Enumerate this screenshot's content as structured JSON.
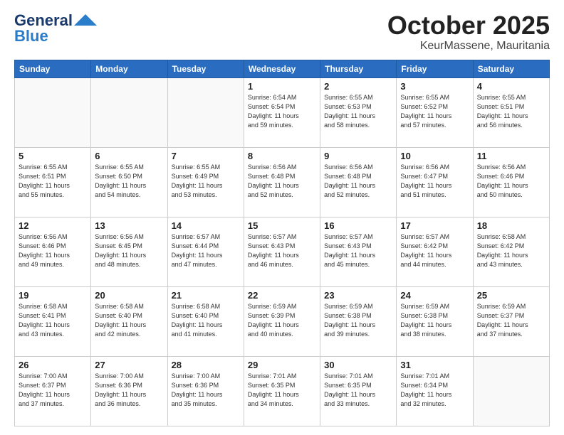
{
  "header": {
    "logo_general": "General",
    "logo_blue": "Blue",
    "month": "October 2025",
    "location": "KeurMassene, Mauritania"
  },
  "weekdays": [
    "Sunday",
    "Monday",
    "Tuesday",
    "Wednesday",
    "Thursday",
    "Friday",
    "Saturday"
  ],
  "weeks": [
    [
      {
        "day": "",
        "info": ""
      },
      {
        "day": "",
        "info": ""
      },
      {
        "day": "",
        "info": ""
      },
      {
        "day": "1",
        "info": "Sunrise: 6:54 AM\nSunset: 6:54 PM\nDaylight: 11 hours\nand 59 minutes."
      },
      {
        "day": "2",
        "info": "Sunrise: 6:55 AM\nSunset: 6:53 PM\nDaylight: 11 hours\nand 58 minutes."
      },
      {
        "day": "3",
        "info": "Sunrise: 6:55 AM\nSunset: 6:52 PM\nDaylight: 11 hours\nand 57 minutes."
      },
      {
        "day": "4",
        "info": "Sunrise: 6:55 AM\nSunset: 6:51 PM\nDaylight: 11 hours\nand 56 minutes."
      }
    ],
    [
      {
        "day": "5",
        "info": "Sunrise: 6:55 AM\nSunset: 6:51 PM\nDaylight: 11 hours\nand 55 minutes."
      },
      {
        "day": "6",
        "info": "Sunrise: 6:55 AM\nSunset: 6:50 PM\nDaylight: 11 hours\nand 54 minutes."
      },
      {
        "day": "7",
        "info": "Sunrise: 6:55 AM\nSunset: 6:49 PM\nDaylight: 11 hours\nand 53 minutes."
      },
      {
        "day": "8",
        "info": "Sunrise: 6:56 AM\nSunset: 6:48 PM\nDaylight: 11 hours\nand 52 minutes."
      },
      {
        "day": "9",
        "info": "Sunrise: 6:56 AM\nSunset: 6:48 PM\nDaylight: 11 hours\nand 52 minutes."
      },
      {
        "day": "10",
        "info": "Sunrise: 6:56 AM\nSunset: 6:47 PM\nDaylight: 11 hours\nand 51 minutes."
      },
      {
        "day": "11",
        "info": "Sunrise: 6:56 AM\nSunset: 6:46 PM\nDaylight: 11 hours\nand 50 minutes."
      }
    ],
    [
      {
        "day": "12",
        "info": "Sunrise: 6:56 AM\nSunset: 6:46 PM\nDaylight: 11 hours\nand 49 minutes."
      },
      {
        "day": "13",
        "info": "Sunrise: 6:56 AM\nSunset: 6:45 PM\nDaylight: 11 hours\nand 48 minutes."
      },
      {
        "day": "14",
        "info": "Sunrise: 6:57 AM\nSunset: 6:44 PM\nDaylight: 11 hours\nand 47 minutes."
      },
      {
        "day": "15",
        "info": "Sunrise: 6:57 AM\nSunset: 6:43 PM\nDaylight: 11 hours\nand 46 minutes."
      },
      {
        "day": "16",
        "info": "Sunrise: 6:57 AM\nSunset: 6:43 PM\nDaylight: 11 hours\nand 45 minutes."
      },
      {
        "day": "17",
        "info": "Sunrise: 6:57 AM\nSunset: 6:42 PM\nDaylight: 11 hours\nand 44 minutes."
      },
      {
        "day": "18",
        "info": "Sunrise: 6:58 AM\nSunset: 6:42 PM\nDaylight: 11 hours\nand 43 minutes."
      }
    ],
    [
      {
        "day": "19",
        "info": "Sunrise: 6:58 AM\nSunset: 6:41 PM\nDaylight: 11 hours\nand 43 minutes."
      },
      {
        "day": "20",
        "info": "Sunrise: 6:58 AM\nSunset: 6:40 PM\nDaylight: 11 hours\nand 42 minutes."
      },
      {
        "day": "21",
        "info": "Sunrise: 6:58 AM\nSunset: 6:40 PM\nDaylight: 11 hours\nand 41 minutes."
      },
      {
        "day": "22",
        "info": "Sunrise: 6:59 AM\nSunset: 6:39 PM\nDaylight: 11 hours\nand 40 minutes."
      },
      {
        "day": "23",
        "info": "Sunrise: 6:59 AM\nSunset: 6:38 PM\nDaylight: 11 hours\nand 39 minutes."
      },
      {
        "day": "24",
        "info": "Sunrise: 6:59 AM\nSunset: 6:38 PM\nDaylight: 11 hours\nand 38 minutes."
      },
      {
        "day": "25",
        "info": "Sunrise: 6:59 AM\nSunset: 6:37 PM\nDaylight: 11 hours\nand 37 minutes."
      }
    ],
    [
      {
        "day": "26",
        "info": "Sunrise: 7:00 AM\nSunset: 6:37 PM\nDaylight: 11 hours\nand 37 minutes."
      },
      {
        "day": "27",
        "info": "Sunrise: 7:00 AM\nSunset: 6:36 PM\nDaylight: 11 hours\nand 36 minutes."
      },
      {
        "day": "28",
        "info": "Sunrise: 7:00 AM\nSunset: 6:36 PM\nDaylight: 11 hours\nand 35 minutes."
      },
      {
        "day": "29",
        "info": "Sunrise: 7:01 AM\nSunset: 6:35 PM\nDaylight: 11 hours\nand 34 minutes."
      },
      {
        "day": "30",
        "info": "Sunrise: 7:01 AM\nSunset: 6:35 PM\nDaylight: 11 hours\nand 33 minutes."
      },
      {
        "day": "31",
        "info": "Sunrise: 7:01 AM\nSunset: 6:34 PM\nDaylight: 11 hours\nand 32 minutes."
      },
      {
        "day": "",
        "info": ""
      }
    ]
  ]
}
